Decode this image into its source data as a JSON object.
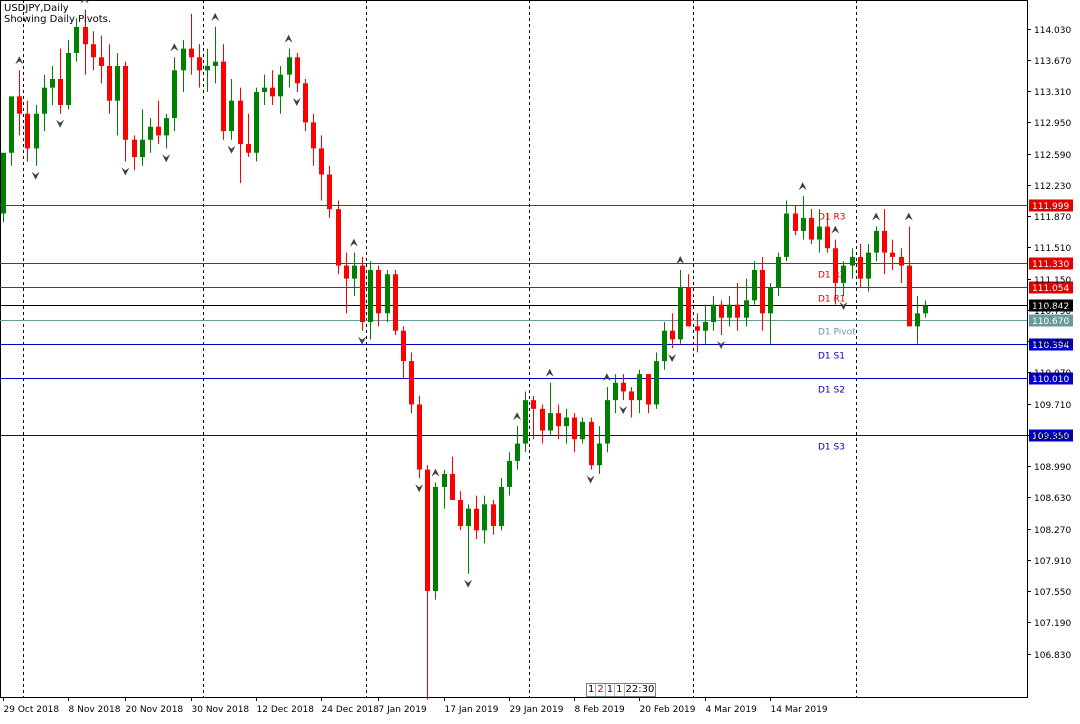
{
  "header": {
    "symbol_line": "USDJPY,Daily",
    "info_line": "Showing Daily Pivots."
  },
  "timeframe_box": {
    "items": [
      {
        "text": "1",
        "color": "#000000"
      },
      {
        "text": "2",
        "color": "#d00000"
      },
      {
        "text": "1",
        "color": "#0000c0"
      },
      {
        "text": "1",
        "color": "#0000c0"
      },
      {
        "text": "22:30",
        "color": "#000000"
      }
    ]
  },
  "chart_data": {
    "type": "candlestick",
    "symbol": "USDJPY",
    "timeframe": "Daily",
    "ylim": [
      106.33,
      114.36
    ],
    "y_ticks": [
      "114.030",
      "113.670",
      "113.310",
      "112.950",
      "112.590",
      "112.230",
      "111.870",
      "111.510",
      "111.150",
      "110.790",
      "110.430",
      "110.070",
      "109.710",
      "109.350",
      "108.990",
      "108.630",
      "108.270",
      "107.910",
      "107.550",
      "107.190",
      "106.830"
    ],
    "x_labels": [
      "29 Oct 2018",
      "8 Nov 2018",
      "20 Nov 2018",
      "30 Nov 2018",
      "12 Dec 2018",
      "24 Dec 2018",
      "7 Jan 2019",
      "17 Jan 2019",
      "29 Jan 2019",
      "8 Feb 2019",
      "20 Feb 2019",
      "4 Mar 2019",
      "14 Mar 2019"
    ],
    "period_separators_after_bar": [
      2,
      24,
      44,
      64,
      84,
      104
    ],
    "current_price": "110.842",
    "colors": {
      "bull": "#008000",
      "bear": "#ff0000",
      "pivot_resistance": "#e00000",
      "pivot_support": "#0000c8",
      "pivot_main": "#6a9a9a",
      "grid": "#000000"
    },
    "pivots": [
      {
        "name": "D1 R3",
        "value": "111.999"
      },
      {
        "name": "D1 R2",
        "value": "111.330"
      },
      {
        "name": "D1 R1",
        "value": "111.054"
      },
      {
        "name": "D1 Pivot",
        "value": "110.670"
      },
      {
        "name": "D1 S1",
        "value": "110.394"
      },
      {
        "name": "D1 S2",
        "value": "110.010"
      },
      {
        "name": "D1 S3",
        "value": "109.350"
      }
    ],
    "fractal_up_bars": [
      2,
      10,
      21,
      26,
      35,
      43,
      53,
      63,
      67,
      74,
      83,
      98,
      102,
      107,
      111
    ],
    "fractal_down_bars": [
      4,
      7,
      15,
      20,
      28,
      36,
      44,
      51,
      57,
      72,
      76,
      82,
      88,
      103
    ],
    "candles": [
      [
        111.9,
        112.55,
        111.8,
        112.6
      ],
      [
        112.6,
        113.2,
        112.45,
        113.25
      ],
      [
        113.25,
        113.55,
        112.8,
        113.05
      ],
      [
        113.05,
        113.2,
        112.5,
        112.65
      ],
      [
        112.65,
        113.15,
        112.45,
        113.05
      ],
      [
        113.05,
        113.5,
        112.85,
        113.35
      ],
      [
        113.35,
        113.6,
        113.15,
        113.45
      ],
      [
        113.45,
        113.8,
        113.05,
        113.15
      ],
      [
        113.15,
        113.9,
        113.1,
        113.75
      ],
      [
        113.75,
        114.15,
        113.65,
        114.05
      ],
      [
        114.05,
        114.25,
        113.5,
        113.85
      ],
      [
        113.85,
        114.0,
        113.55,
        113.7
      ],
      [
        113.7,
        113.95,
        113.4,
        113.6
      ],
      [
        113.6,
        113.85,
        113.05,
        113.2
      ],
      [
        113.2,
        113.75,
        112.8,
        113.6
      ],
      [
        113.6,
        113.65,
        112.5,
        112.75
      ],
      [
        112.75,
        112.8,
        112.4,
        112.55
      ],
      [
        112.55,
        113.1,
        112.45,
        112.75
      ],
      [
        112.75,
        113.0,
        112.6,
        112.9
      ],
      [
        112.9,
        113.2,
        112.7,
        112.8
      ],
      [
        112.8,
        113.05,
        112.65,
        113.0
      ],
      [
        113.0,
        113.7,
        112.85,
        113.55
      ],
      [
        113.55,
        113.9,
        113.3,
        113.8
      ],
      [
        113.8,
        114.2,
        113.5,
        113.7
      ],
      [
        113.7,
        113.85,
        113.35,
        113.55
      ],
      [
        113.55,
        113.8,
        113.3,
        113.6
      ],
      [
        113.6,
        114.05,
        113.4,
        113.65
      ],
      [
        113.65,
        113.85,
        112.75,
        112.85
      ],
      [
        112.85,
        113.45,
        112.75,
        113.2
      ],
      [
        113.2,
        113.35,
        112.25,
        112.7
      ],
      [
        112.7,
        113.05,
        112.55,
        112.6
      ],
      [
        112.6,
        113.35,
        112.5,
        113.3
      ],
      [
        113.3,
        113.5,
        113.15,
        113.35
      ],
      [
        113.35,
        113.55,
        113.15,
        113.25
      ],
      [
        113.25,
        113.6,
        113.05,
        113.5
      ],
      [
        113.5,
        113.8,
        113.35,
        113.7
      ],
      [
        113.7,
        113.75,
        113.3,
        113.4
      ],
      [
        113.4,
        113.45,
        112.85,
        112.95
      ],
      [
        112.95,
        113.05,
        112.45,
        112.65
      ],
      [
        112.65,
        112.8,
        112.05,
        112.35
      ],
      [
        112.35,
        112.45,
        111.85,
        111.95
      ],
      [
        111.95,
        112.05,
        111.2,
        111.3
      ],
      [
        111.3,
        111.45,
        110.75,
        111.15
      ],
      [
        111.15,
        111.45,
        110.95,
        111.3
      ],
      [
        111.3,
        111.4,
        110.55,
        110.65
      ],
      [
        110.65,
        111.35,
        110.45,
        111.25
      ],
      [
        111.25,
        111.3,
        110.6,
        110.75
      ],
      [
        110.75,
        111.25,
        110.65,
        111.2
      ],
      [
        111.2,
        111.25,
        110.5,
        110.55
      ],
      [
        110.55,
        110.6,
        110.0,
        110.2
      ],
      [
        110.2,
        110.3,
        109.6,
        109.7
      ],
      [
        109.7,
        109.8,
        108.85,
        108.95
      ],
      [
        108.95,
        109.0,
        106.3,
        107.55
      ],
      [
        107.55,
        108.8,
        107.45,
        108.75
      ],
      [
        108.75,
        108.95,
        108.5,
        108.9
      ],
      [
        108.9,
        109.1,
        108.6,
        108.6
      ],
      [
        108.6,
        108.7,
        108.25,
        108.3
      ],
      [
        108.3,
        108.55,
        107.75,
        108.5
      ],
      [
        108.5,
        108.65,
        108.15,
        108.25
      ],
      [
        108.25,
        108.65,
        108.1,
        108.55
      ],
      [
        108.55,
        108.6,
        108.2,
        108.3
      ],
      [
        108.3,
        108.85,
        108.25,
        108.75
      ],
      [
        108.75,
        109.15,
        108.65,
        109.05
      ],
      [
        109.05,
        109.45,
        108.95,
        109.25
      ],
      [
        109.25,
        109.85,
        109.15,
        109.75
      ],
      [
        109.75,
        109.8,
        109.3,
        109.65
      ],
      [
        109.65,
        109.7,
        109.25,
        109.4
      ],
      [
        109.4,
        109.95,
        109.35,
        109.6
      ],
      [
        109.6,
        109.7,
        109.3,
        109.45
      ],
      [
        109.45,
        109.65,
        109.25,
        109.55
      ],
      [
        109.55,
        109.6,
        109.15,
        109.3
      ],
      [
        109.3,
        109.55,
        109.25,
        109.5
      ],
      [
        109.5,
        109.55,
        108.95,
        109.0
      ],
      [
        109.0,
        109.45,
        108.9,
        109.25
      ],
      [
        109.25,
        109.9,
        109.15,
        109.75
      ],
      [
        109.75,
        110.05,
        109.6,
        109.95
      ],
      [
        109.95,
        110.05,
        109.75,
        109.85
      ],
      [
        109.85,
        109.9,
        109.55,
        109.75
      ],
      [
        109.75,
        110.1,
        109.6,
        110.05
      ],
      [
        110.05,
        109.95,
        109.6,
        109.7
      ],
      [
        109.7,
        110.3,
        109.65,
        110.2
      ],
      [
        110.2,
        110.65,
        110.1,
        110.55
      ],
      [
        110.55,
        110.75,
        110.35,
        110.45
      ],
      [
        110.45,
        111.25,
        110.4,
        111.05
      ],
      [
        111.05,
        111.2,
        110.6,
        110.6
      ],
      [
        110.6,
        110.75,
        110.3,
        110.55
      ],
      [
        110.55,
        110.85,
        110.4,
        110.65
      ],
      [
        110.65,
        110.95,
        110.55,
        110.85
      ],
      [
        110.85,
        110.9,
        110.5,
        110.7
      ],
      [
        110.7,
        110.95,
        110.6,
        110.85
      ],
      [
        110.85,
        111.1,
        110.55,
        110.7
      ],
      [
        110.7,
        111.15,
        110.6,
        110.9
      ],
      [
        110.9,
        111.35,
        110.85,
        111.25
      ],
      [
        111.25,
        111.4,
        110.55,
        110.75
      ],
      [
        110.75,
        111.1,
        110.4,
        111.05
      ],
      [
        111.05,
        111.45,
        110.95,
        111.4
      ],
      [
        111.4,
        112.05,
        111.35,
        111.9
      ],
      [
        111.9,
        112.0,
        111.65,
        111.7
      ],
      [
        111.7,
        112.1,
        111.6,
        111.85
      ],
      [
        111.85,
        111.95,
        111.55,
        111.6
      ],
      [
        111.6,
        111.95,
        111.45,
        111.75
      ],
      [
        111.75,
        111.9,
        111.45,
        111.5
      ],
      [
        111.5,
        111.6,
        110.85,
        111.1
      ],
      [
        111.1,
        111.35,
        110.95,
        111.3
      ],
      [
        111.3,
        111.5,
        111.15,
        111.4
      ],
      [
        111.4,
        111.55,
        111.05,
        111.15
      ],
      [
        111.15,
        111.55,
        111.0,
        111.45
      ],
      [
        111.45,
        111.75,
        111.35,
        111.7
      ],
      [
        111.7,
        111.95,
        111.2,
        111.45
      ],
      [
        111.45,
        111.6,
        111.25,
        111.4
      ],
      [
        111.4,
        111.5,
        111.1,
        111.3
      ],
      [
        111.3,
        111.75,
        110.65,
        110.6
      ],
      [
        110.6,
        110.95,
        110.4,
        110.75
      ],
      [
        110.75,
        110.9,
        110.7,
        110.84
      ]
    ]
  }
}
